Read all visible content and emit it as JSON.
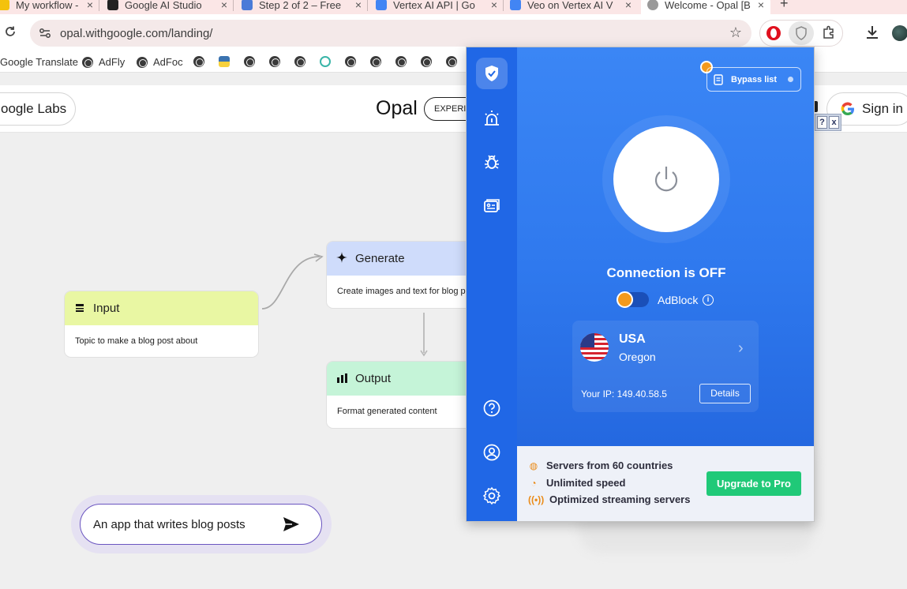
{
  "browser": {
    "tabs": [
      {
        "title": "My workflow -",
        "icon_color": "#f4c20d"
      },
      {
        "title": "Google AI Studio",
        "icon_color": "#222222"
      },
      {
        "title": "Step 2 of 2 – Free",
        "icon_color": "#4a7bd8"
      },
      {
        "title": "Vertex AI API | Go",
        "icon_color": "#4285f4"
      },
      {
        "title": "Veo on Vertex AI V",
        "icon_color": "#4285f4"
      },
      {
        "title": "Welcome - Opal [B",
        "icon_color": "#999999"
      }
    ],
    "new_tab_label": "+",
    "url": "opal.withgoogle.com/landing/",
    "bookmarks": [
      "Google Translate",
      "AdFly",
      "AdFoc"
    ]
  },
  "site": {
    "labs_label": "oogle Labs",
    "logo": "Opal",
    "badge": "EXPERIMENT",
    "signin_label": "Sign in",
    "help_label": "?",
    "close_label": "x"
  },
  "canvas": {
    "nodes": {
      "input": {
        "title": "Input",
        "description": "Topic to make a blog post about",
        "color": "#e9f7a3"
      },
      "generate": {
        "title": "Generate",
        "description": "Create images and text for blog p",
        "color": "#cfdcfb"
      },
      "output": {
        "title": "Output",
        "description": "Format generated content",
        "color": "#c5f4d8"
      }
    },
    "prompt": {
      "text": "An app that writes blog posts"
    }
  },
  "vpn": {
    "bypass_label": "Bypass list",
    "status": "Connection is OFF",
    "adblock_label": "AdBlock",
    "adblock_enabled": false,
    "location": {
      "country": "USA",
      "region": "Oregon"
    },
    "ip_text": "Your IP: 149.40.58.5",
    "details_label": "Details",
    "features": [
      "Servers from 60 countries",
      "Unlimited speed",
      "Optimized streaming servers"
    ],
    "upgrade_label": "Upgrade to Pro",
    "colors": {
      "main": "#2f79ee",
      "upgrade": "#20c978",
      "crown": "#f39a1d"
    }
  }
}
